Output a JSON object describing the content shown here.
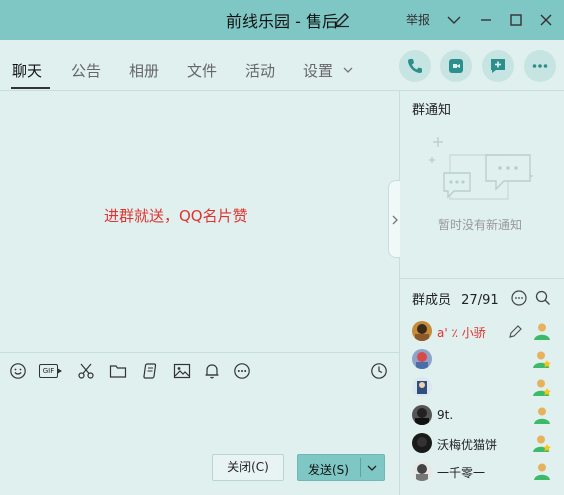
{
  "window": {
    "title": "前线乐园 - 售后",
    "report_label": "举报"
  },
  "tabs": [
    {
      "label": "聊天",
      "active": true
    },
    {
      "label": "公告",
      "active": false
    },
    {
      "label": "相册",
      "active": false
    },
    {
      "label": "文件",
      "active": false
    },
    {
      "label": "活动",
      "active": false
    },
    {
      "label": "设置",
      "active": false
    }
  ],
  "header_actions": [
    "phone-icon",
    "video-icon",
    "message-plus-icon",
    "more-icon"
  ],
  "chat": {
    "notice_text": "进群就送，QQ名片赞"
  },
  "toolbar": {
    "icons": [
      "emoji-icon",
      "gif-icon",
      "scissors-icon",
      "folder-icon",
      "shake-icon",
      "image-icon",
      "bell-icon",
      "more-icon",
      "history-icon"
    ],
    "gif_label": "GIF"
  },
  "buttons": {
    "close_label": "关闭(C)",
    "send_label": "发送(S)"
  },
  "notice_panel": {
    "title": "群通知",
    "empty_text": "暂时没有新通知"
  },
  "members": {
    "header_label": "群成员",
    "count": "27/91",
    "list": [
      {
        "name": "a' ٪  小骄",
        "highlight": true,
        "role": "owner",
        "editable": true
      },
      {
        "name": "",
        "highlight": false,
        "role": "admin",
        "editable": false
      },
      {
        "name": "",
        "highlight": false,
        "role": "admin",
        "editable": false
      },
      {
        "name": "9t.",
        "highlight": false,
        "role": "member",
        "editable": false
      },
      {
        "name": "沃梅优猫饼",
        "highlight": false,
        "role": "admin",
        "editable": false
      },
      {
        "name": "一千零一",
        "highlight": false,
        "role": "member",
        "editable": false
      }
    ]
  },
  "colors": {
    "titlebar": "#7fc7c5",
    "background": "#dff0ef",
    "accent_red": "#e0332f",
    "icon_teal": "#2d8f8c"
  }
}
